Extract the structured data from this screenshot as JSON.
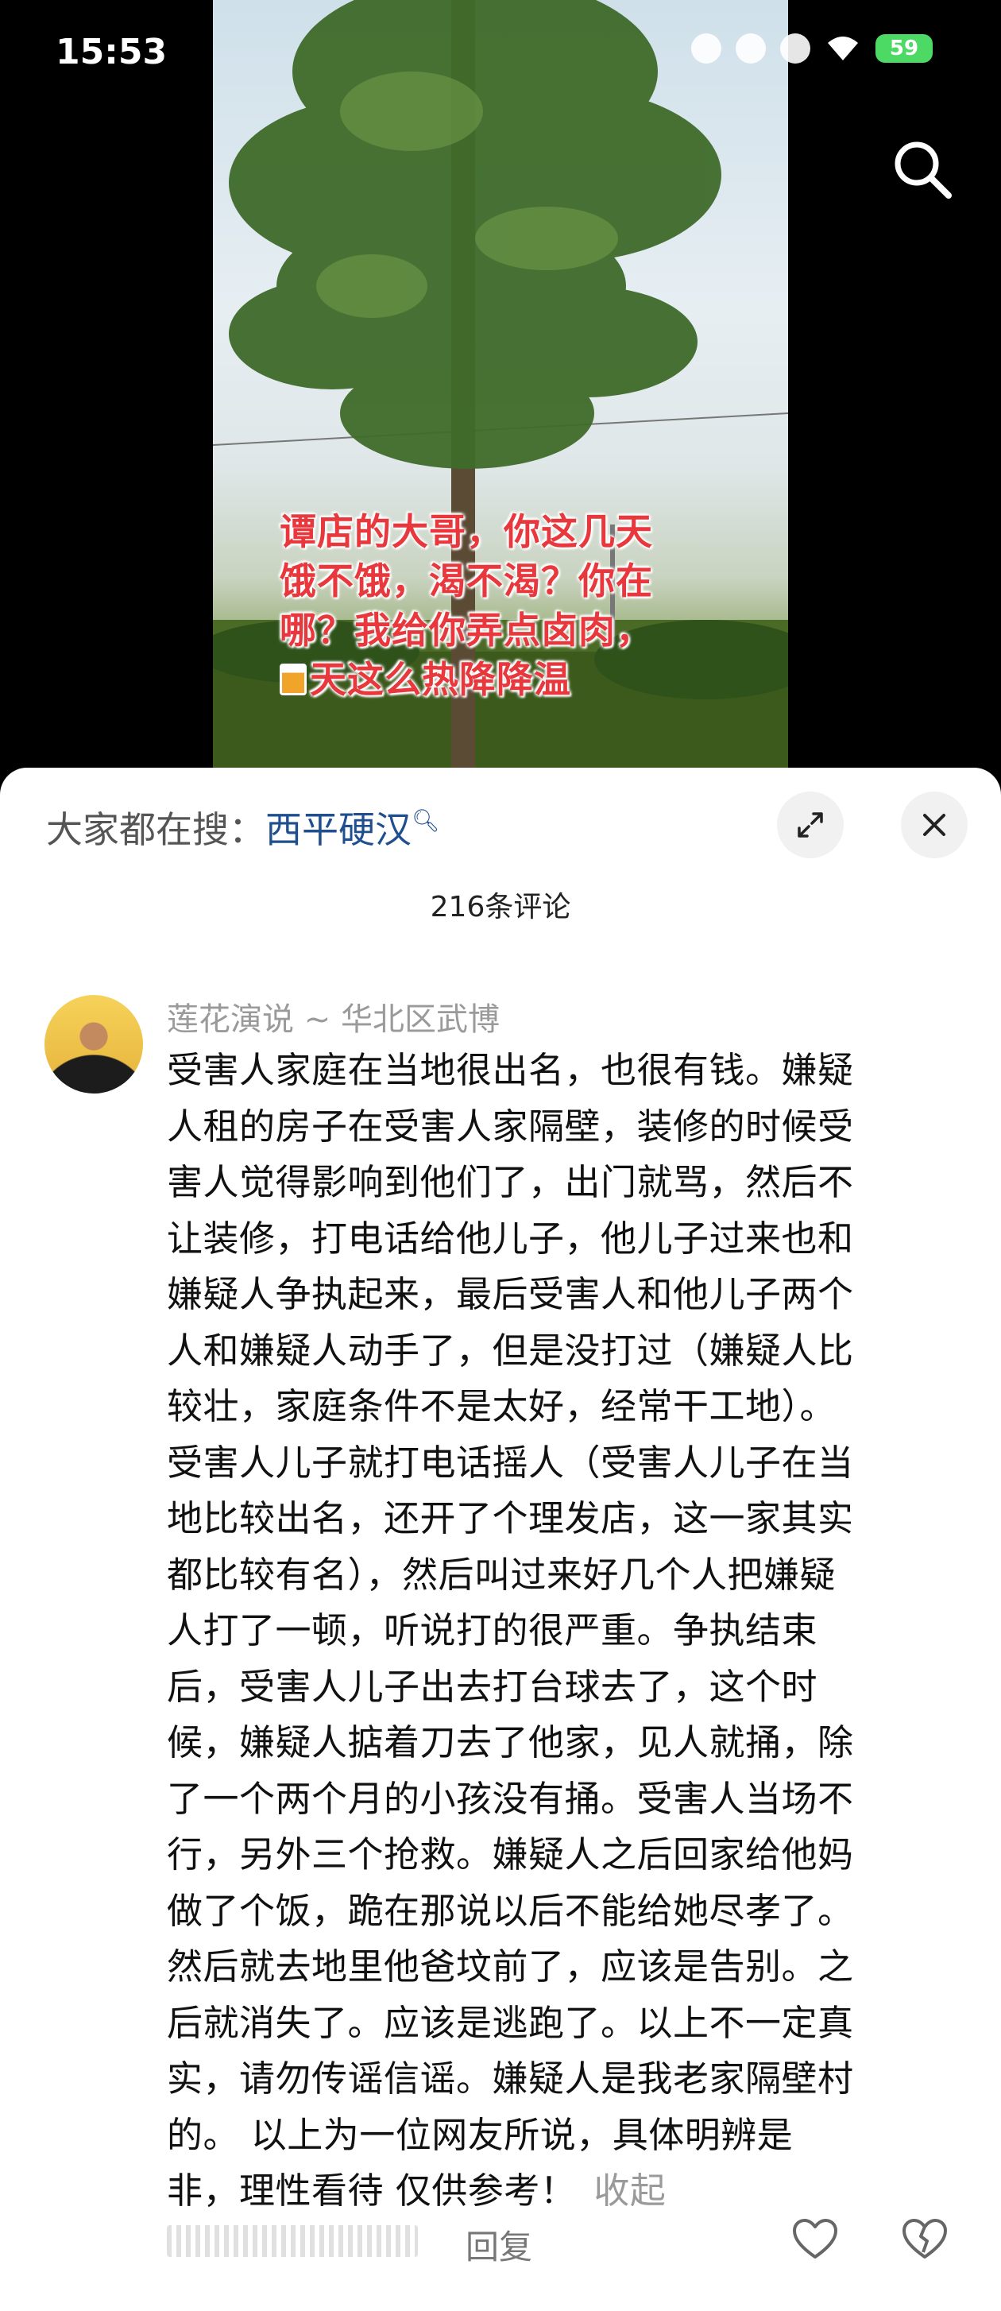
{
  "status": {
    "time": "15:53",
    "battery": "59"
  },
  "video": {
    "caption_lines": [
      "谭店的大哥，你这几天",
      "饿不饿，渴不渴？你在",
      "哪？我给你弄点卤肉，",
      "天这么热降降温"
    ],
    "caption_emoji": "beer-mug-icon"
  },
  "sheet": {
    "trending_prefix": "大家都在搜：",
    "trending_keyword": "西平硬汉",
    "comment_count": "216条评论"
  },
  "comment": {
    "author": "莲花演说 ~ 华北区武博",
    "lines": [
      "受害人家庭在当地很出名，也很有钱。嫌疑",
      "人租的房子在受害人家隔壁，装修的时候受",
      "害人觉得影响到他们了，出门就骂，然后不",
      "让装修，打电话给他儿子，他儿子过来也和",
      "嫌疑人争执起来，最后受害人和他儿子两个",
      "人和嫌疑人动手了，但是没打过（嫌疑人比",
      "较壮，家庭条件不是太好，经常干工地）。",
      "受害人儿子就打电话摇人（受害人儿子在当",
      "地比较出名，还开了个理发店，这一家其实",
      "都比较有名），然后叫过来好几个人把嫌疑",
      "人打了一顿，听说打的很严重。争执结束",
      "后，受害人儿子出去打台球去了，这个时",
      "候，嫌疑人掂着刀去了他家，见人就捅，除",
      "了一个两个月的小孩没有捅。受害人当场不",
      "行，另外三个抢救。嫌疑人之后回家给他妈",
      "做了个饭，跪在那说以后不能给她尽孝了。",
      "然后就去地里他爸坟前了，应该是告别。之",
      "后就消失了。应该是逃跑了。以上不一定真",
      "实，请勿传谣信谣。嫌疑人是我老家隔壁村",
      "的。 以上为一位网友所说，具体明辨是",
      "非，理性看待 仅供参考！"
    ],
    "collapse_label": "收起",
    "reply_label": "回复"
  },
  "colors": {
    "accent_link": "#1f4f8f",
    "caption_red": "#e8383d"
  }
}
